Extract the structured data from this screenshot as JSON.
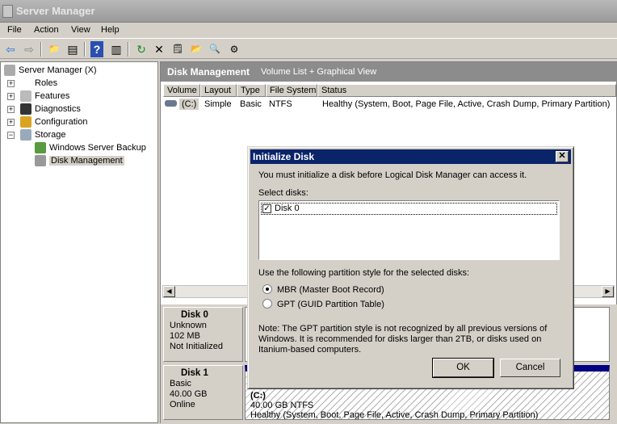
{
  "window": {
    "title": "Server Manager"
  },
  "menu": [
    "File",
    "Action",
    "View",
    "Help"
  ],
  "toolbar": {
    "icons": [
      "back-icon",
      "forward-icon",
      "up-folder-icon",
      "show-hide-tree-icon",
      "help-icon",
      "show-action-pane-icon",
      "refresh-icon",
      "delete-icon",
      "properties-icon",
      "open-icon",
      "search-icon",
      "settings-icon"
    ],
    "glyphs": [
      "⇦",
      "⇨",
      "📁",
      "▤",
      "?",
      "▥",
      "↻",
      "✕",
      "🗒",
      "📂",
      "🔍",
      "⚙"
    ]
  },
  "tree": {
    "root": "Server Manager (X)",
    "items": [
      {
        "label": "Roles",
        "expander": "+"
      },
      {
        "label": "Features",
        "expander": "+"
      },
      {
        "label": "Diagnostics",
        "expander": "+"
      },
      {
        "label": "Configuration",
        "expander": "+"
      },
      {
        "label": "Storage",
        "expander": "−"
      }
    ],
    "children": [
      "Windows Server Backup",
      "Disk Management"
    ]
  },
  "pane": {
    "title": "Disk Management",
    "view": "Volume List + Graphical View",
    "columns": [
      "Volume",
      "Layout",
      "Type",
      "File System",
      "Status"
    ],
    "rows": [
      {
        "volume": "(C:)",
        "layout": "Simple",
        "type": "Basic",
        "fs": "NTFS",
        "status": "Healthy (System, Boot, Page File, Active, Crash Dump, Primary Partition)"
      }
    ]
  },
  "disks": [
    {
      "name": "Disk 0",
      "type": "Unknown",
      "size": "102 MB",
      "state": "Not Initialized"
    },
    {
      "name": "Disk 1",
      "type": "Basic",
      "size": "40.00 GB",
      "state": "Online",
      "partition": {
        "label": "(C:)",
        "size": "40.00 GB NTFS",
        "status": "Healthy (System, Boot, Page File, Active, Crash Dump, Primary Partition)"
      }
    }
  ],
  "dialog": {
    "title": "Initialize Disk",
    "close": "✕",
    "intro": "You must initialize a disk before Logical Disk Manager can access it.",
    "select_label": "Select disks:",
    "disks": [
      {
        "label": "Disk 0",
        "checked": true
      }
    ],
    "style_label": "Use the following partition style for the selected disks:",
    "options": [
      {
        "label": "MBR (Master Boot Record)",
        "selected": true
      },
      {
        "label": "GPT (GUID Partition Table)",
        "selected": false
      }
    ],
    "note": "Note: The GPT partition style is not recognized by all previous versions of Windows. It is recommended for disks larger than 2TB, or disks used on Itanium-based computers.",
    "ok": "OK",
    "cancel": "Cancel"
  }
}
